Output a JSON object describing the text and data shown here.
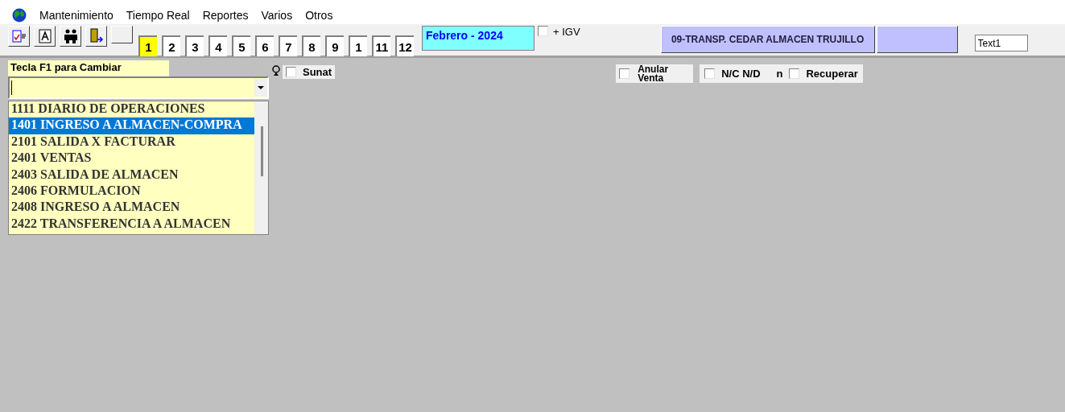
{
  "menu": [
    "Mantenimiento",
    "Tiempo Real",
    "Reportes",
    "Varios",
    "Otros"
  ],
  "toolbar": {
    "tools": [
      {
        "kind": "document"
      },
      {
        "kind": "letter"
      },
      {
        "kind": "people"
      },
      {
        "kind": "door"
      },
      {
        "kind": "blank"
      }
    ],
    "months": [
      {
        "label": "1",
        "selected": true
      },
      {
        "label": "2",
        "selected": false
      },
      {
        "label": "3",
        "selected": false
      },
      {
        "label": "4",
        "selected": false
      },
      {
        "label": "5",
        "selected": false
      },
      {
        "label": "6",
        "selected": false
      },
      {
        "label": "7",
        "selected": false
      },
      {
        "label": "8",
        "selected": false
      },
      {
        "label": "9",
        "selected": false
      },
      {
        "label": "1",
        "selected": false
      },
      {
        "label": "11",
        "selected": false
      },
      {
        "label": "12",
        "selected": false
      }
    ],
    "period": "Febrero - 2024",
    "igv": {
      "label": "+ IGV",
      "checked": false
    },
    "company": "09-TRANSP. CEDAR  ALMACEN TRUJILLO",
    "text_field": {
      "value": "Text1"
    }
  },
  "form": {
    "hint": "Tecla  F1 para Cambiar",
    "options": [
      {
        "code": "1111",
        "name": "DIARIO DE OPERACIONES",
        "selected": false
      },
      {
        "code": "1401",
        "name": "INGRESO A ALMACEN-COMPRA",
        "selected": true
      },
      {
        "code": "2101",
        "name": "SALIDA X FACTURAR",
        "selected": false
      },
      {
        "code": "2401",
        "name": "VENTAS",
        "selected": false
      },
      {
        "code": "2403",
        "name": "SALIDA DE ALMACEN",
        "selected": false
      },
      {
        "code": "2406",
        "name": "FORMULACION",
        "selected": false
      },
      {
        "code": "2408",
        "name": "INGRESO A ALMACEN",
        "selected": false
      },
      {
        "code": "2422",
        "name": "TRANSFERENCIA A ALMACEN",
        "selected": false
      }
    ],
    "sunat": {
      "label": "Sunat",
      "checked": false
    },
    "anular": {
      "label": "Anular Venta",
      "checked": false
    },
    "ncnd": {
      "label": "N/C N/D",
      "checked": false
    },
    "n_label": "n",
    "recuperar": {
      "label": "Recuperar",
      "checked": false
    }
  }
}
